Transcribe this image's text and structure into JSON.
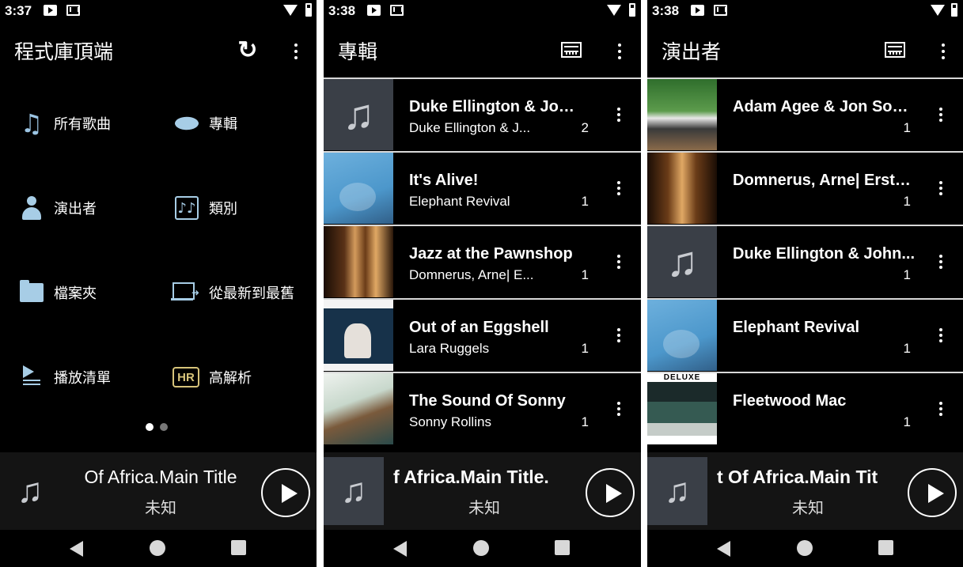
{
  "panel1": {
    "time": "3:37",
    "title": "程式庫頂端",
    "menu": [
      {
        "label": "所有歌曲",
        "icon": "music-note-icon"
      },
      {
        "label": "專輯",
        "icon": "disc-icon"
      },
      {
        "label": "演出者",
        "icon": "person-icon"
      },
      {
        "label": "類別",
        "icon": "genre-icon"
      },
      {
        "label": "檔案夾",
        "icon": "folder-icon"
      },
      {
        "label": "從最新到最舊",
        "icon": "newest-first-icon"
      },
      {
        "label": "播放清單",
        "icon": "playlist-icon"
      },
      {
        "label": "高解析",
        "icon": "hr-icon"
      }
    ],
    "hr_badge": "HR",
    "genre_glyph": "♪♪",
    "page_dots": {
      "count": 2,
      "active": 0
    }
  },
  "panel2": {
    "time": "3:38",
    "title": "專輯",
    "rows": [
      {
        "title": "Duke Ellington & John...",
        "subtitle": "Duke Ellington & J...",
        "count": "2",
        "art": "placeholder-note"
      },
      {
        "title": "It's Alive!",
        "subtitle": "Elephant Revival",
        "count": "1",
        "art": "elephant-revival-cover"
      },
      {
        "title": "Jazz at the Pawnshop",
        "subtitle": "Domnerus, Arne| E...",
        "count": "1",
        "art": "pawnshop-cover"
      },
      {
        "title": "Out of an Eggshell",
        "subtitle": "Lara Ruggels",
        "count": "1",
        "art": "eggshell-cover"
      },
      {
        "title": "The Sound Of Sonny",
        "subtitle": "Sonny Rollins",
        "count": "1",
        "art": "sonny-cover"
      }
    ]
  },
  "panel3": {
    "time": "3:38",
    "title": "演出者",
    "rows": [
      {
        "title": "Adam Agee & Jon Sousa",
        "count": "1",
        "art": "adam-agee-cover"
      },
      {
        "title": "Domnerus, Arne| Erstra...",
        "count": "1",
        "art": "pawnshop-cover"
      },
      {
        "title": "Duke Ellington & John...",
        "count": "1",
        "art": "placeholder-note"
      },
      {
        "title": "Elephant Revival",
        "count": "1",
        "art": "elephant-revival-cover"
      },
      {
        "title": "Fleetwood Mac",
        "count": "1",
        "art": "fleetwood-cover"
      }
    ],
    "fleetwood_badge": "DELUXE"
  },
  "now_playing": {
    "panel1_title": "Of Africa.Main Title",
    "panel2_title": "f Africa.Main Title.",
    "panel3_title": "t Of Africa.Main Tit",
    "artist": "未知"
  },
  "colors": {
    "background": "#000000",
    "accent_icon": "#a7cde6",
    "hr_gold": "#d6c37a",
    "divider": "#d8d8d8"
  }
}
